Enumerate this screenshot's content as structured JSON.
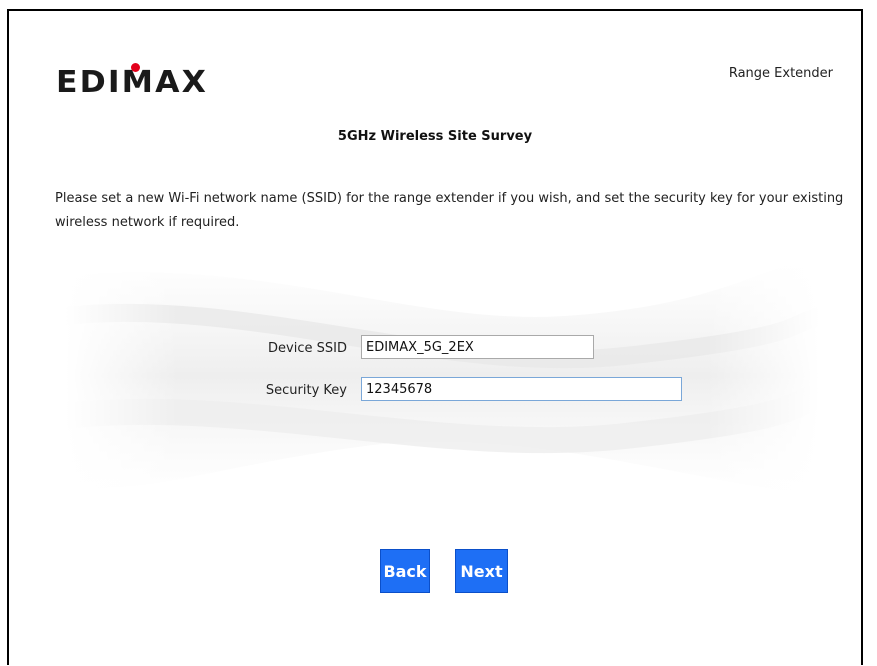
{
  "header": {
    "brand_logo": "EDIMAX",
    "product_name": "Range Extender"
  },
  "page": {
    "title": "5GHz Wireless Site Survey",
    "instructions": "Please set a new Wi-Fi network name (SSID) for the range extender if you wish, and set the security key for your existing wireless network if required."
  },
  "form": {
    "ssid_label": "Device SSID",
    "ssid_value": "EDIMAX_5G_2EX",
    "key_label": "Security Key",
    "key_value": "12345678"
  },
  "buttons": {
    "back_label": "Back",
    "next_label": "Next"
  },
  "colors": {
    "button_blue": "#1e6ff5",
    "logo_red_dot": "#e3001b"
  }
}
